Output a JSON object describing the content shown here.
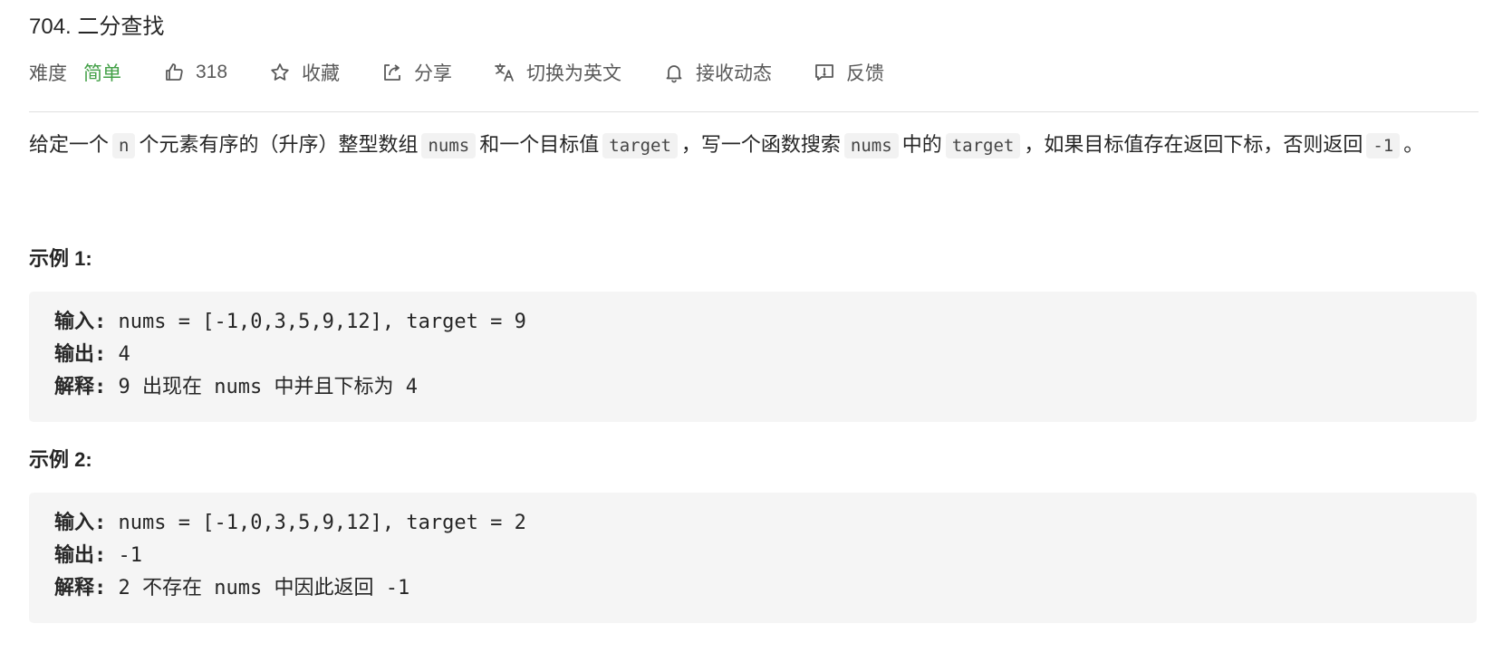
{
  "problem": {
    "title": "704. 二分查找",
    "difficulty_label": "难度",
    "difficulty_value": "简单",
    "likes": "318",
    "actions": {
      "favorite": "收藏",
      "share": "分享",
      "switch_lang": "切换为英文",
      "subscribe": "接收动态",
      "feedback": "反馈"
    }
  },
  "description": {
    "p1": "给定一个",
    "c1": "n",
    "p2": "个元素有序的（升序）整型数组",
    "c2": "nums",
    "p3": "和一个目标值",
    "c3": "target",
    "p4": "，写一个函数搜索",
    "c4": "nums",
    "p5": "中的",
    "c5": "target",
    "p6": "，如果目标值存在返回下标，否则返回",
    "c6": "-1",
    "p7": "。"
  },
  "examples": [
    {
      "title": "示例 1:",
      "input_label": "输入:",
      "input": " nums = [-1,0,3,5,9,12], target = 9",
      "output_label": "输出:",
      "output": " 4",
      "explain_label": "解释:",
      "explain": " 9 出现在 nums 中并且下标为 4"
    },
    {
      "title": "示例 2:",
      "input_label": "输入:",
      "input": " nums = [-1,0,3,5,9,12], target = 2",
      "output_label": "输出:",
      "output": " -1",
      "explain_label": "解释:",
      "explain": " 2 不存在 nums 中因此返回 -1"
    }
  ],
  "colors": {
    "difficulty_easy": "#43a047",
    "code_bg": "#f5f5f5",
    "divider": "#e0e0e0"
  },
  "icons": [
    "thumbs-up-icon",
    "star-icon",
    "share-icon",
    "translate-icon",
    "bell-icon",
    "feedback-icon"
  ]
}
